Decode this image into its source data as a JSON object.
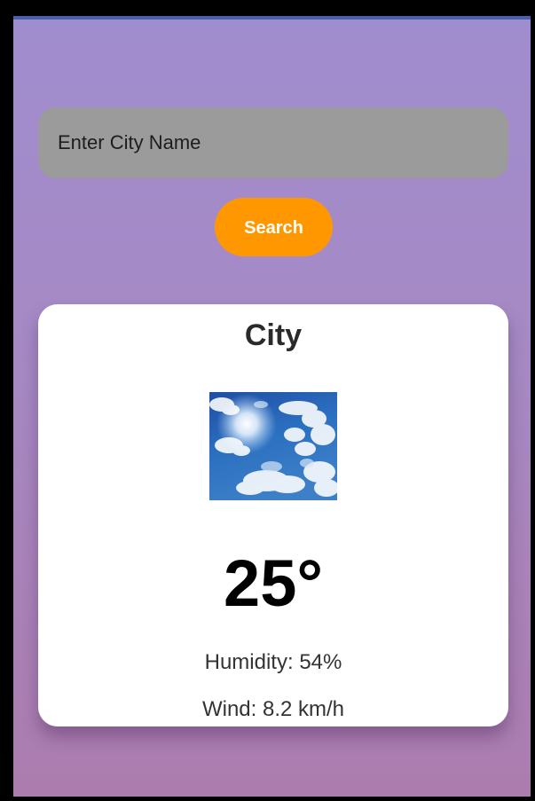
{
  "search": {
    "placeholder": "Enter City Name",
    "value": "",
    "button_label": "Search"
  },
  "weather": {
    "city": "City",
    "temperature": "25°",
    "humidity": "Humidity: 54%",
    "wind": "Wind: 8.2 km/h",
    "image_icon": "sunny-sky-image"
  },
  "colors": {
    "background_top": "#a08dcf",
    "background_bottom": "#ac7cae",
    "input_background": "#9b9b9b",
    "button_accent": "#ff9800",
    "card_background": "#ffffff"
  }
}
